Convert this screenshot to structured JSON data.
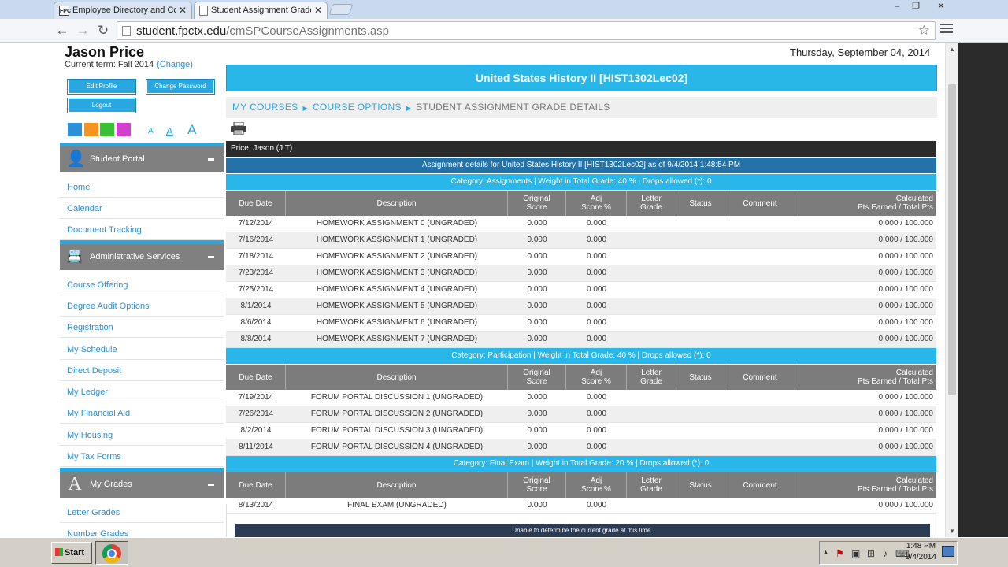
{
  "browser": {
    "tabs": [
      {
        "favicon": "FPC",
        "title": "Employee Directory and Cor"
      },
      {
        "title": "Student Assignment Grade D"
      }
    ],
    "url_host": "student.fpctx.edu",
    "url_path": "/cmSPCourseAssignments.asp",
    "window_controls": [
      "‒",
      "❐",
      "✕"
    ]
  },
  "user": {
    "name": "Jason Price",
    "term": "Current term: Fall 2014",
    "change_label": "(Change)"
  },
  "buttons": {
    "edit_profile": "Edit Profile",
    "change_password": "Change Password",
    "logout": "Logout"
  },
  "theme_colors": [
    "#2d8fd5",
    "#f7941d",
    "#39c134",
    "#d53fd0"
  ],
  "font_size_labels": [
    "A",
    "A",
    "A"
  ],
  "sections": {
    "student_portal": {
      "title": "Student Portal",
      "links": [
        "Home",
        "Calendar",
        "Document Tracking"
      ]
    },
    "admin_services": {
      "title": "Administrative Services",
      "links": [
        "Course Offering",
        "Degree Audit Options",
        "Registration",
        "My Schedule",
        "Direct Deposit",
        "My Ledger",
        "My Financial Aid",
        "My Housing",
        "My Tax Forms"
      ]
    },
    "my_grades": {
      "title": "My Grades",
      "links": [
        "Letter Grades",
        "Number Grades"
      ]
    }
  },
  "date": "Thursday, September 04, 2014",
  "course_title": "United States History II [HIST1302Lec02]",
  "breadcrumb": {
    "my_courses": "MY COURSES",
    "course_options": "COURSE OPTIONS",
    "current": "STUDENT ASSIGNMENT GRADE DETAILS"
  },
  "student_label": "Price, Jason (J T)",
  "assignment_details": "Assignment details for United States History II [HIST1302Lec02] as of 9/4/2014 1:48:54 PM",
  "table_headers": {
    "due_date": "Due Date",
    "description": "Description",
    "original_score_1": "Original",
    "original_score_2": "Score",
    "adj_score_1": "Adj",
    "adj_score_2": "Score %",
    "letter_grade_1": "Letter",
    "letter_grade_2": "Grade",
    "status": "Status",
    "comment": "Comment",
    "calculated_1": "Calculated",
    "calculated_2": "Pts Earned / Total Pts"
  },
  "categories": [
    {
      "title": "Category: Assignments | Weight in Total Grade: 40 % | Drops allowed (*): 0",
      "rows": [
        {
          "due": "7/12/2014",
          "desc": "HOMEWORK ASSIGNMENT 0 (UNGRADED)",
          "orig": "0.000",
          "adj": "0.000",
          "pts": "0.000 / 100.000"
        },
        {
          "due": "7/16/2014",
          "desc": "HOMEWORK ASSIGNMENT 1 (UNGRADED)",
          "orig": "0.000",
          "adj": "0.000",
          "pts": "0.000 / 100.000"
        },
        {
          "due": "7/18/2014",
          "desc": "HOMEWORK ASSIGNMENT 2 (UNGRADED)",
          "orig": "0.000",
          "adj": "0.000",
          "pts": "0.000 / 100.000"
        },
        {
          "due": "7/23/2014",
          "desc": "HOMEWORK ASSIGNMENT 3 (UNGRADED)",
          "orig": "0.000",
          "adj": "0.000",
          "pts": "0.000 / 100.000"
        },
        {
          "due": "7/25/2014",
          "desc": "HOMEWORK ASSIGNMENT 4 (UNGRADED)",
          "orig": "0.000",
          "adj": "0.000",
          "pts": "0.000 / 100.000"
        },
        {
          "due": "8/1/2014",
          "desc": "HOMEWORK ASSIGNMENT 5 (UNGRADED)",
          "orig": "0.000",
          "adj": "0.000",
          "pts": "0.000 / 100.000"
        },
        {
          "due": "8/6/2014",
          "desc": "HOMEWORK ASSIGNMENT 6 (UNGRADED)",
          "orig": "0.000",
          "adj": "0.000",
          "pts": "0.000 / 100.000"
        },
        {
          "due": "8/8/2014",
          "desc": "HOMEWORK ASSIGNMENT 7 (UNGRADED)",
          "orig": "0.000",
          "adj": "0.000",
          "pts": "0.000 / 100.000"
        }
      ]
    },
    {
      "title": "Category: Participation | Weight in Total Grade: 40 % | Drops allowed (*): 0",
      "rows": [
        {
          "due": "7/19/2014",
          "desc": "FORUM PORTAL DISCUSSION 1 (UNGRADED)",
          "orig": "0.000",
          "adj": "0.000",
          "pts": "0.000 / 100.000"
        },
        {
          "due": "7/26/2014",
          "desc": "FORUM PORTAL DISCUSSION 2 (UNGRADED)",
          "orig": "0.000",
          "adj": "0.000",
          "pts": "0.000 / 100.000"
        },
        {
          "due": "8/2/2014",
          "desc": "FORUM PORTAL DISCUSSION 3 (UNGRADED)",
          "orig": "0.000",
          "adj": "0.000",
          "pts": "0.000 / 100.000"
        },
        {
          "due": "8/11/2014",
          "desc": "FORUM PORTAL DISCUSSION 4 (UNGRADED)",
          "orig": "0.000",
          "adj": "0.000",
          "pts": "0.000 / 100.000"
        }
      ]
    },
    {
      "title": "Category: Final Exam | Weight in Total Grade: 20 % | Drops allowed (*): 0",
      "rows": [
        {
          "due": "8/13/2014",
          "desc": "FINAL EXAM (UNGRADED)",
          "orig": "0.000",
          "adj": "0.000",
          "pts": "0.000 / 100.000"
        }
      ]
    }
  ],
  "grade_message": "Unable to determine the current grade at this time.",
  "taskbar": {
    "start": "Start",
    "time": "1:48 PM",
    "date": "9/4/2014"
  }
}
